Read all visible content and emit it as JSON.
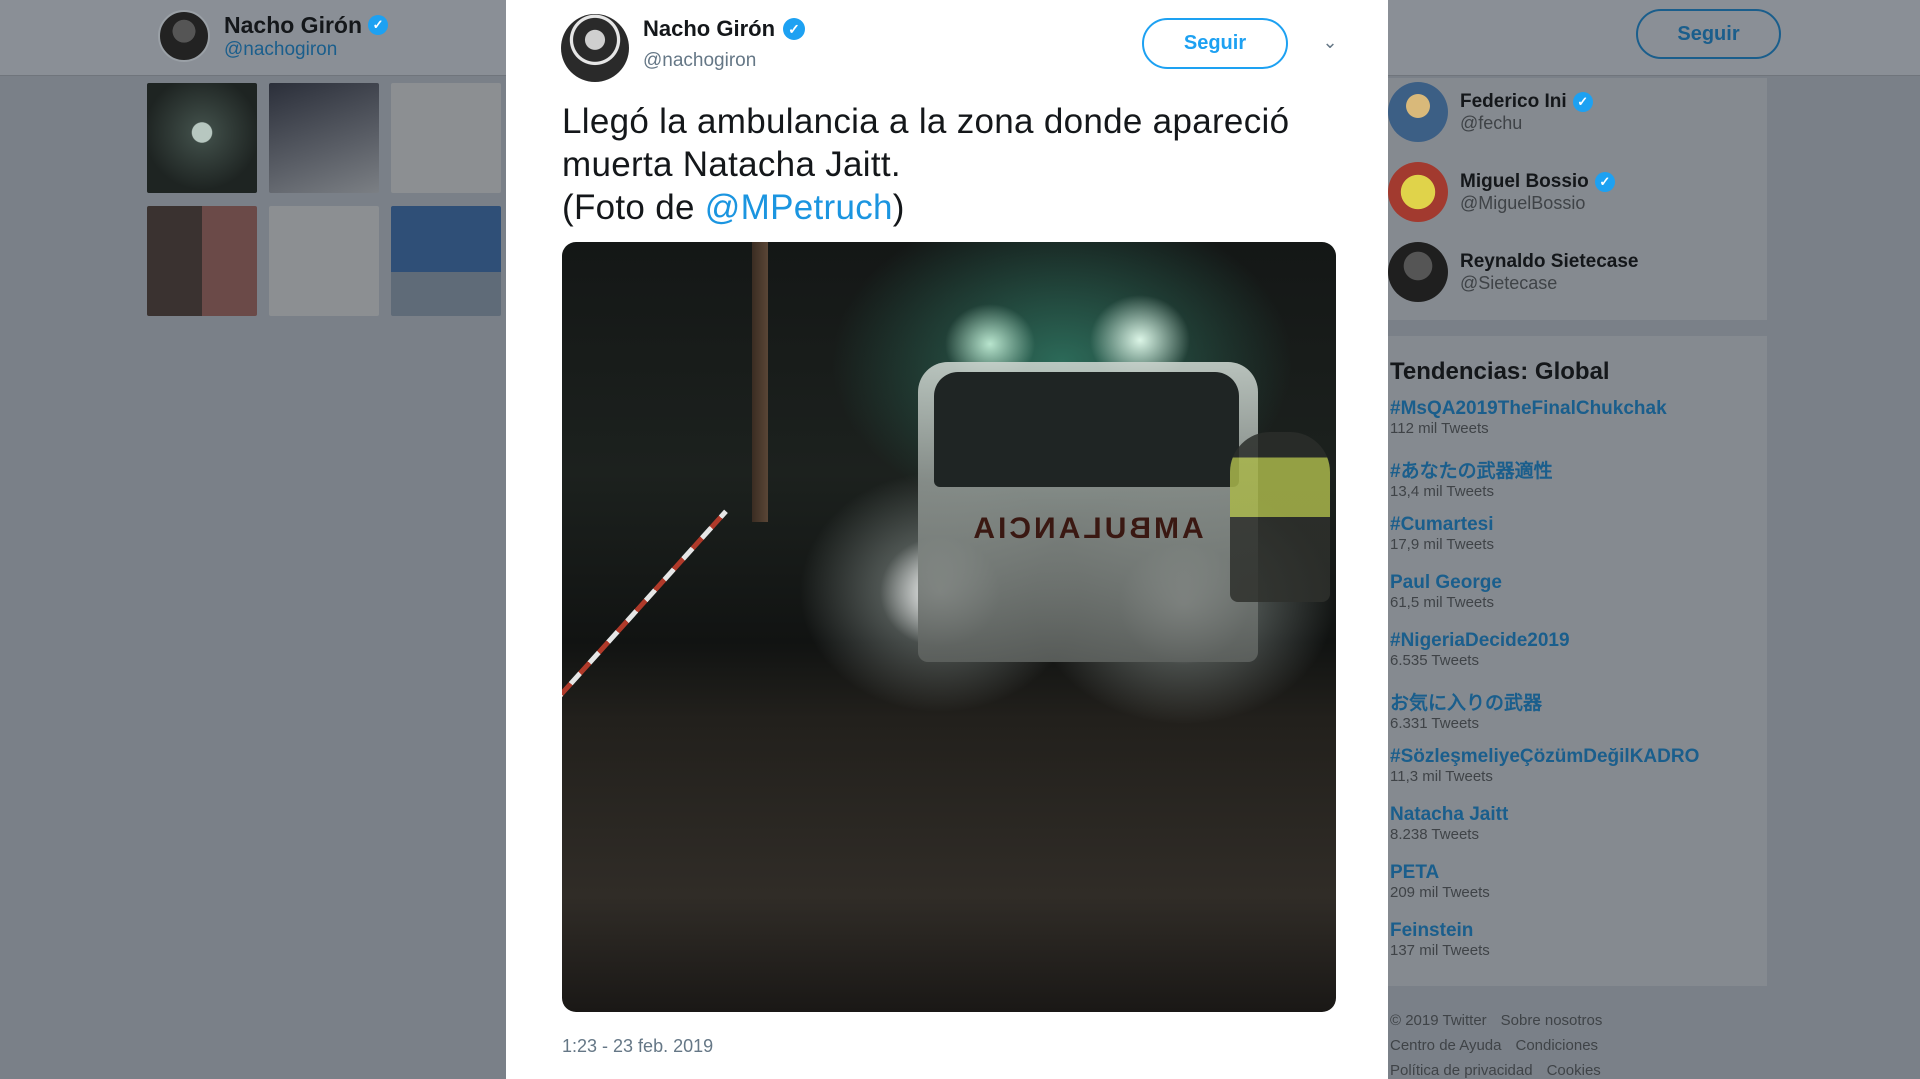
{
  "background": {
    "profile": {
      "name": "Nacho Girón",
      "handle": "@nachogiron"
    },
    "seguir_label": "Seguir",
    "thumbnails": [
      "ambulance-photo",
      "police-car-photo",
      "tweet-screenshot",
      "people-photo",
      "text-screenshot",
      "tv-screenshot"
    ],
    "who_to_follow": [
      {
        "name": "Federico Ini",
        "handle": "@fechu",
        "verified": true
      },
      {
        "name": "Miguel Bossio",
        "handle": "@MiguelBossio",
        "verified": true
      },
      {
        "name": "Reynaldo Sietecase",
        "handle": "@Sietecase",
        "verified": false
      }
    ],
    "trends_title": "Tendencias: Global",
    "trends": [
      {
        "name": "#MsQA2019TheFinalChukchak",
        "count": "112 mil Tweets"
      },
      {
        "name": "#あなたの武器適性",
        "count": "13,4 mil Tweets"
      },
      {
        "name": "#Cumartesi",
        "count": "17,9 mil Tweets"
      },
      {
        "name": "Paul George",
        "count": "61,5 mil Tweets"
      },
      {
        "name": "#NigeriaDecide2019",
        "count": "6.535 Tweets"
      },
      {
        "name": "お気に入りの武器",
        "count": "6.331 Tweets"
      },
      {
        "name": "#SözleşmeliyeÇözümDeğilKADRO",
        "count": "11,3 mil Tweets"
      },
      {
        "name": "Natacha Jaitt",
        "count": "8.238 Tweets"
      },
      {
        "name": "PETA",
        "count": "209 mil Tweets"
      },
      {
        "name": "Feinstein",
        "count": "137 mil Tweets"
      }
    ],
    "footer": [
      "© 2019 Twitter",
      "Sobre nosotros",
      "Centro de Ayuda",
      "Condiciones",
      "Política de privacidad",
      "Cookies"
    ]
  },
  "tweet": {
    "author_name": "Nacho Girón",
    "author_handle": "@nachogiron",
    "follow_label": "Seguir",
    "text_line1": "Llegó la ambulancia a la zona donde apareció",
    "text_line2": "muerta Natacha Jaitt.",
    "text_line3_prefix": "(Foto de ",
    "text_mention": "@MPetruch",
    "text_line3_suffix": ")",
    "photo_label": "AMBULANCIA",
    "timestamp": "1:23 - 23 feb. 2019"
  },
  "colors": {
    "accent": "#1da1f2",
    "mention": "#1b95e0",
    "overlay": "#7a8088"
  }
}
